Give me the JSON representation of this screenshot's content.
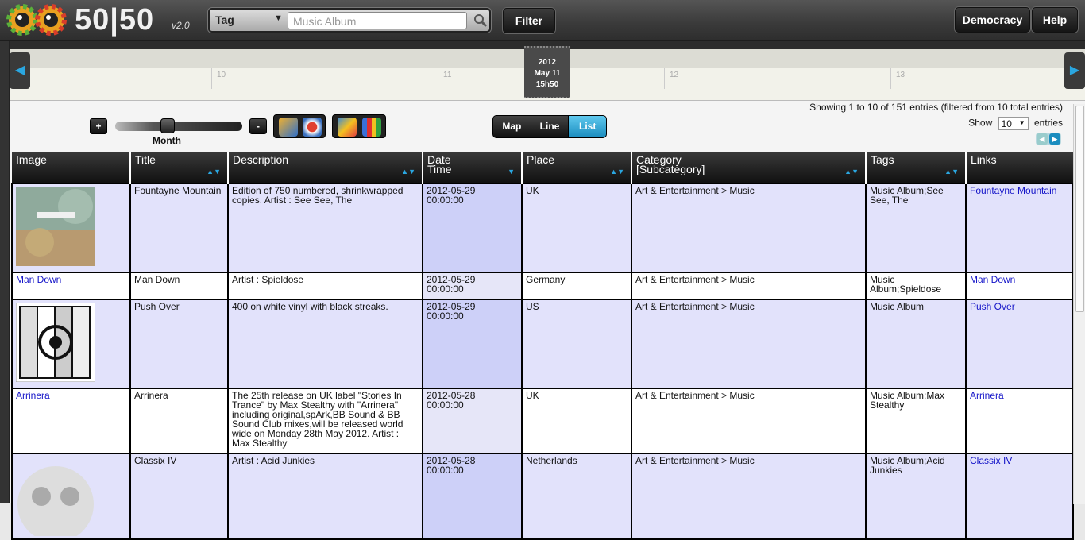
{
  "app": {
    "logo": "50|50",
    "version": "v2.0"
  },
  "search": {
    "type_label": "Tag",
    "placeholder": "Music Album"
  },
  "buttons": {
    "filter": "Filter",
    "democracy": "Democracy",
    "help": "Help"
  },
  "timeline": {
    "ticks": [
      "10",
      "11",
      "12",
      "13"
    ],
    "current": {
      "year": "2012",
      "date": "May 11",
      "time": "15h50"
    }
  },
  "controls": {
    "zoom_in": "+",
    "zoom_out": "-",
    "scale_label": "Month",
    "views": [
      "Map",
      "Line",
      "List"
    ],
    "active_view": "List"
  },
  "info": {
    "showing": "Showing 1 to 10 of 151 entries (filtered from 10 total entries)",
    "show_label": "Show",
    "entries_label": "entries",
    "page_size": "10"
  },
  "table": {
    "headers": {
      "image": "Image",
      "title": "Title",
      "description": "Description",
      "date": "Date",
      "time": "Time",
      "place": "Place",
      "category": "Category",
      "subcategory": "[Subcategory]",
      "tags": "Tags",
      "links": "Links"
    },
    "rows": [
      {
        "image_text": "",
        "title": "Fountayne Mountain",
        "description": "Edition of 750 numbered, shrinkwrapped copies. Artist : See See, The",
        "date": "2012-05-29",
        "time": "00:00:00",
        "place": "UK",
        "category": "Art & Entertainment > Music",
        "tags": "Music Album;See See, The",
        "link": "Fountayne Mountain"
      },
      {
        "image_text": "Man Down",
        "title": "Man Down",
        "description": "Artist : Spieldose",
        "date": "2012-05-29",
        "time": "00:00:00",
        "place": "Germany",
        "category": "Art & Entertainment > Music",
        "tags": "Music Album;Spieldose",
        "link": "Man Down"
      },
      {
        "image_text": "",
        "title": "Push Over",
        "description": "400 on white vinyl with black streaks.",
        "date": "2012-05-29",
        "time": "00:00:00",
        "place": "US",
        "category": "Art & Entertainment > Music",
        "tags": "Music Album",
        "link": "Push Over"
      },
      {
        "image_text": "Arrinera",
        "title": "Arrinera",
        "description": "The 25th release on UK label \"Stories In Trance\" by Max Stealthy with \"Arrinera\" including original,spArk,BB Sound & BB Sound Club mixes,will be released world wide on Monday 28th May 2012. Artist : Max Stealthy",
        "date": "2012-05-28",
        "time": "00:00:00",
        "place": "UK",
        "category": "Art & Entertainment > Music",
        "tags": "Music Album;Max Stealthy",
        "link": "Arrinera"
      },
      {
        "image_text": "",
        "title": "Classix IV",
        "description": "Artist : Acid Junkies",
        "date": "2012-05-28",
        "time": "00:00:00",
        "place": "Netherlands",
        "category": "Art & Entertainment > Music",
        "tags": "Music Album;Acid Junkies",
        "link": "Classix IV"
      }
    ]
  },
  "colors": {
    "accent": "#2aa6e0",
    "link": "#1414c8",
    "row_odd": "#e2e2fb",
    "date_odd": "#cdd0f8"
  }
}
